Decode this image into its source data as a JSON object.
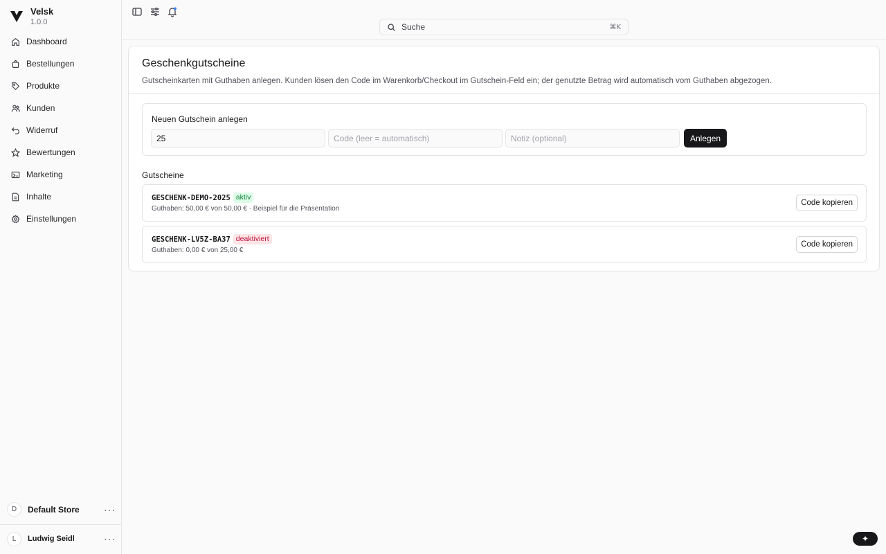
{
  "brand": {
    "name": "Velsk",
    "version": "1.0.0"
  },
  "nav": [
    {
      "label": "Dashboard",
      "icon": "home-icon"
    },
    {
      "label": "Bestellungen",
      "icon": "bag-icon"
    },
    {
      "label": "Produkte",
      "icon": "tag-icon"
    },
    {
      "label": "Kunden",
      "icon": "users-icon"
    },
    {
      "label": "Widerruf",
      "icon": "undo-icon"
    },
    {
      "label": "Bewertungen",
      "icon": "star-icon"
    },
    {
      "label": "Marketing",
      "icon": "ticket-icon"
    },
    {
      "label": "Inhalte",
      "icon": "file-icon"
    },
    {
      "label": "Einstellungen",
      "icon": "gear-icon"
    }
  ],
  "store": {
    "initial": "D",
    "name": "Default Store",
    "menu": "···"
  },
  "user": {
    "initial": "L",
    "name": "Ludwig Seidl",
    "menu": "···"
  },
  "search": {
    "placeholder": "Suche",
    "shortcut": "⌘K"
  },
  "page": {
    "title": "Geschenkgutscheine",
    "description": "Gutscheinkarten mit Guthaben anlegen. Kunden lösen den Code im Warenkorb/Checkout im Gutschein-Feld ein; der genutzte Betrag wird automatisch vom Guthaben abgezogen."
  },
  "create": {
    "title": "Neuen Gutschein anlegen",
    "amount_value": "25",
    "code_placeholder": "Code (leer = automatisch)",
    "note_placeholder": "Notiz (optional)",
    "submit_label": "Anlegen"
  },
  "list": {
    "title": "Gutscheine",
    "copy_label": "Code kopieren",
    "items": [
      {
        "code": "GESCHENK-DEMO-2025",
        "status": "aktiv",
        "detail": "Guthaben: 50,00 € von 50,00 € · Beispiel für die Präsentation"
      },
      {
        "code": "GESCHENK-LV5Z-BA37",
        "status": "deaktiviert",
        "detail": "Guthaben: 0,00 € von 25,00 €"
      }
    ]
  },
  "fab": {
    "icon": "sparkle-icon",
    "glyph": "✦"
  },
  "colors": {
    "primary": "#18181b",
    "active_bg": "#dcfce7",
    "active_fg": "#15803d",
    "inactive_bg": "#ffe4e6",
    "inactive_fg": "#be123c"
  }
}
